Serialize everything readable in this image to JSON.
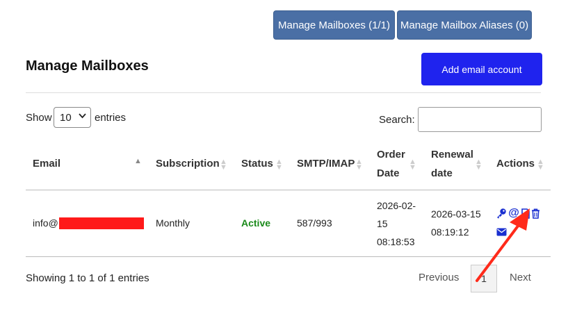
{
  "header": {
    "cut_text": "",
    "manage_mailboxes_btn": "Manage Mailboxes (1/1)",
    "manage_aliases_btn": "Manage Mailbox Aliases (0)"
  },
  "section": {
    "title": "Manage Mailboxes",
    "add_button": "Add email account"
  },
  "controls": {
    "show_label": "Show",
    "entries_value": "10",
    "entries_label": "entries",
    "search_label": "Search:",
    "search_value": ""
  },
  "table": {
    "headers": {
      "email": "Email",
      "subscription": "Subscription",
      "status": "Status",
      "smtp": "SMTP/IMAP",
      "order_1": "Order",
      "order_2": "Date",
      "renewal_1": "Renewal",
      "renewal_2": "date",
      "actions": "Actions"
    },
    "row": {
      "email_prefix": "info@",
      "subscription": "Monthly",
      "status": "Active",
      "smtp": "587/993",
      "order_date_1": "2026-02-",
      "order_date_2": "15",
      "order_time": "08:18:53",
      "renewal_date": "2026-03-15",
      "renewal_time": "08:19:12"
    },
    "action_icons": [
      "key-icon",
      "at-icon",
      "file-icon",
      "trash-icon",
      "envelope-icon"
    ]
  },
  "footer": {
    "info": "Showing 1 to 1 of 1 entries",
    "previous": "Previous",
    "page": "1",
    "next": "Next"
  },
  "colors": {
    "top_button": "#4a6fa5",
    "add_button": "#1f23ee",
    "status_active": "#1a8a1a",
    "icon": "#1a2fd0",
    "annotation_arrow": "#ff2a1a",
    "redaction": "#ff1a1a"
  }
}
